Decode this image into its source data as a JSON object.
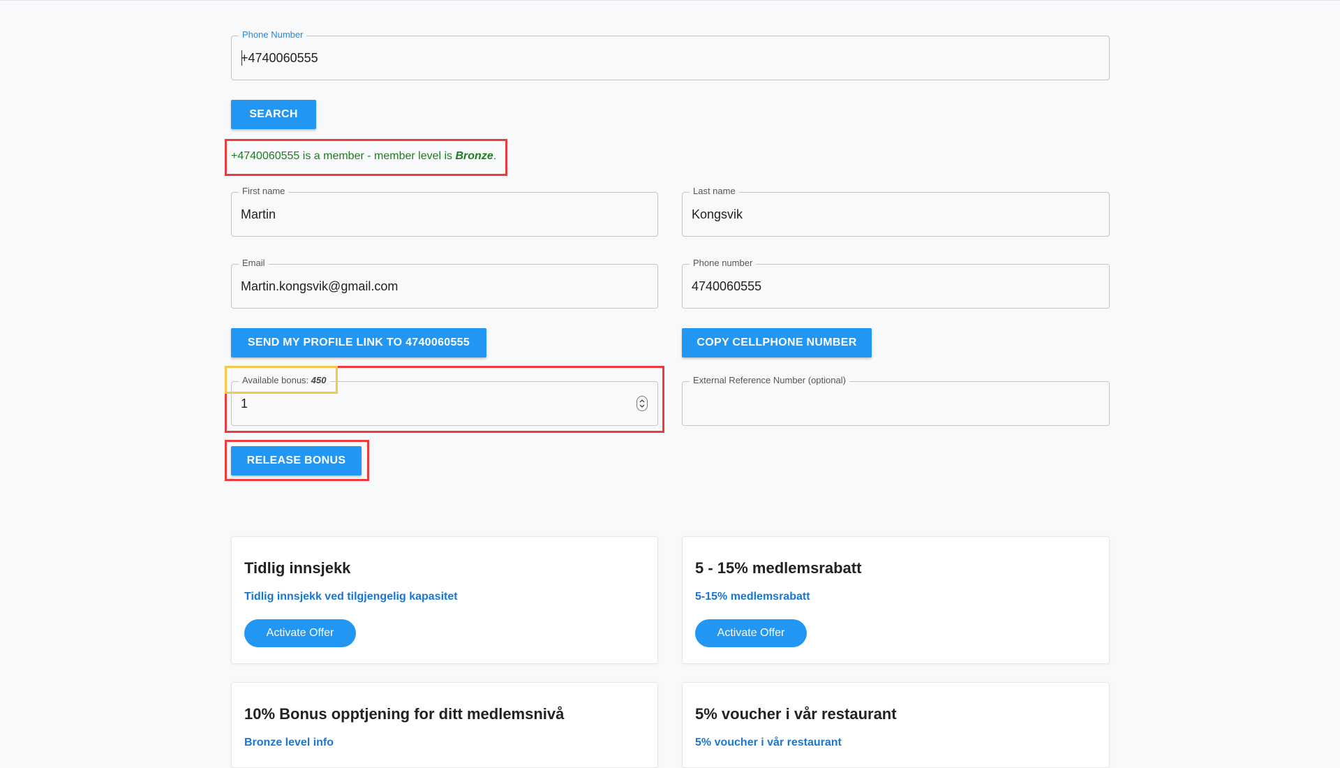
{
  "search": {
    "phone_label": "Phone Number",
    "phone_value": "+4740060555",
    "search_button": "SEARCH"
  },
  "member_status": {
    "prefix": "+4740060555 is a member - member level is ",
    "level": "Bronze",
    "suffix": "."
  },
  "profile": {
    "first_name_label": "First name",
    "first_name_value": "Martin",
    "last_name_label": "Last name",
    "last_name_value": "Kongsvik",
    "email_label": "Email",
    "email_value": "Martin.kongsvik@gmail.com",
    "phone_label": "Phone number",
    "phone_value": "4740060555",
    "send_link_button": "SEND MY PROFILE LINK TO 4740060555",
    "copy_phone_button": "COPY CELLPHONE NUMBER"
  },
  "bonus": {
    "available_label": "Available bonus:",
    "available_value": "450",
    "amount_value": "1",
    "external_ref_label": "External Reference Number (optional)",
    "release_button": "RELEASE BONUS"
  },
  "offers": [
    {
      "title": "Tidlig innsjekk",
      "subtitle": "Tidlig innsjekk ved tilgjengelig kapasitet",
      "button": "Activate Offer"
    },
    {
      "title": "5 - 15% medlemsrabatt",
      "subtitle": "5-15% medlemsrabatt",
      "button": "Activate Offer"
    },
    {
      "title": "10% Bonus opptjening for ditt medlemsnivå",
      "subtitle": "Bronze level info"
    },
    {
      "title": "5% voucher i vår restaurant",
      "subtitle": "5% voucher i vår restaurant"
    }
  ],
  "colors": {
    "primary": "#2196f3",
    "success_text": "#1e7d1e",
    "highlight_red": "#ef3b3b",
    "highlight_yellow": "#f6c94c",
    "link_blue": "#1976d2"
  }
}
